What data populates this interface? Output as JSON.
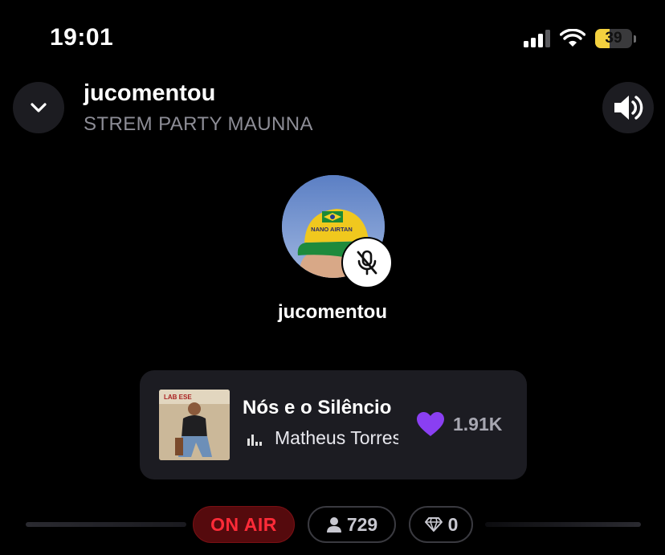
{
  "status_bar": {
    "time": "19:01",
    "battery_percent": "39",
    "battery_level": 0.39,
    "signal_bars": 4,
    "signal_bars_active": 3
  },
  "header": {
    "title": "jucomentou",
    "subtitle": "STREM PARTY MAUNNA"
  },
  "host": {
    "name": "jucomentou",
    "muted": true,
    "avatar_cap_text": "NANO AIRTAN"
  },
  "now_playing": {
    "title": "Nós e o Silêncio",
    "artist": "Matheus Torres",
    "likes": "1.91K",
    "heart_color": "#8a3ff2",
    "album_text": "LAB ESE"
  },
  "stats": {
    "on_air_label": "ON AIR",
    "listeners": "729",
    "gems": "0"
  },
  "colors": {
    "background": "#000000",
    "accent_red": "#ff2b38",
    "battery": "#f3d13f",
    "subtitle_gray": "#8d8d96"
  },
  "icons": [
    "chevron-down-icon",
    "speaker-icon",
    "mic-off-icon",
    "heart-icon",
    "equalizer-icon",
    "person-icon",
    "diamond-icon",
    "wifi-icon",
    "signal-icon",
    "battery-icon"
  ]
}
